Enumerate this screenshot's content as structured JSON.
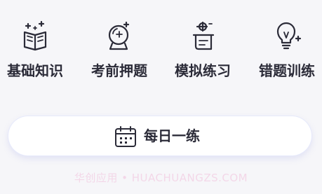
{
  "menu": {
    "items": [
      {
        "label": "基础知识",
        "icon": "open-book-sparkle-icon"
      },
      {
        "label": "考前押题",
        "icon": "crystal-ball-icon"
      },
      {
        "label": "模拟练习",
        "icon": "scroll-exam-icon"
      },
      {
        "label": "错题训练",
        "icon": "lightbulb-sparkle-icon"
      }
    ]
  },
  "daily": {
    "label": "每日一练",
    "icon": "calendar-icon"
  },
  "watermark": {
    "text": "华创应用 • HUACHUANGZS.COM"
  },
  "colors": {
    "background": "#f6f6f9",
    "text": "#2b2b38",
    "icon_stroke": "#2b2b38",
    "button_bg": "#ffffff",
    "watermark": "#f3d7e8"
  }
}
